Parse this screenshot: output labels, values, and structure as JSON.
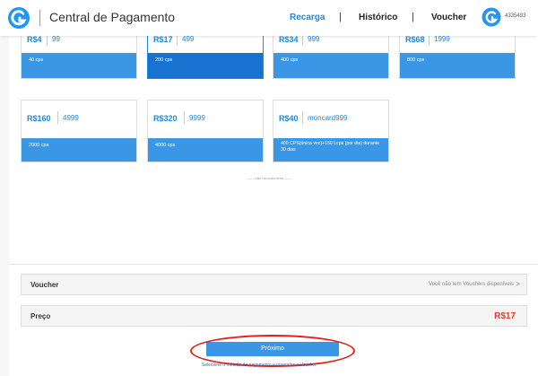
{
  "header": {
    "title": "Central de Pagamento",
    "nav": [
      {
        "label": "Recarga",
        "active": true
      },
      {
        "label": "Histórico",
        "active": false
      },
      {
        "label": "Voucher",
        "active": false
      }
    ],
    "divider": "|",
    "user_id": "4335493",
    "logo_icon": "garena-logo-icon",
    "accent_color": "#1e88e5"
  },
  "packages": [
    {
      "price": "R$4",
      "units": "99",
      "desc": "40 cps",
      "selected": false
    },
    {
      "price": "R$17",
      "units": "499",
      "desc": "200 cps",
      "selected": true
    },
    {
      "price": "R$34",
      "units": "999",
      "desc": "400 cps",
      "selected": false
    },
    {
      "price": "R$68",
      "units": "1999",
      "desc": "800 cps",
      "selected": false
    },
    {
      "price": "R$160",
      "units": "4999",
      "desc": "2000 cps",
      "selected": false
    },
    {
      "price": "R$320",
      "units": "9999",
      "desc": "4000 cps",
      "selected": false
    },
    {
      "price": "R$40",
      "units": "moncard999",
      "desc": "400 CPS(única vez)+150 Lcps (por dia) durante 30 dias",
      "selected": false
    }
  ],
  "no_more": "—— Não há mais itens ——",
  "voucher": {
    "label": "Voucher",
    "status": "Você não tem Vouchers disponíveis",
    "chevron": ">"
  },
  "price_row": {
    "label": "Preço",
    "value": "R$17",
    "value_color": "#e53935"
  },
  "next_button": {
    "label": "Próximo"
  },
  "hint": "Selecione o método de pagamento e preencha o Voucher.",
  "highlight_color": "#e0201b"
}
